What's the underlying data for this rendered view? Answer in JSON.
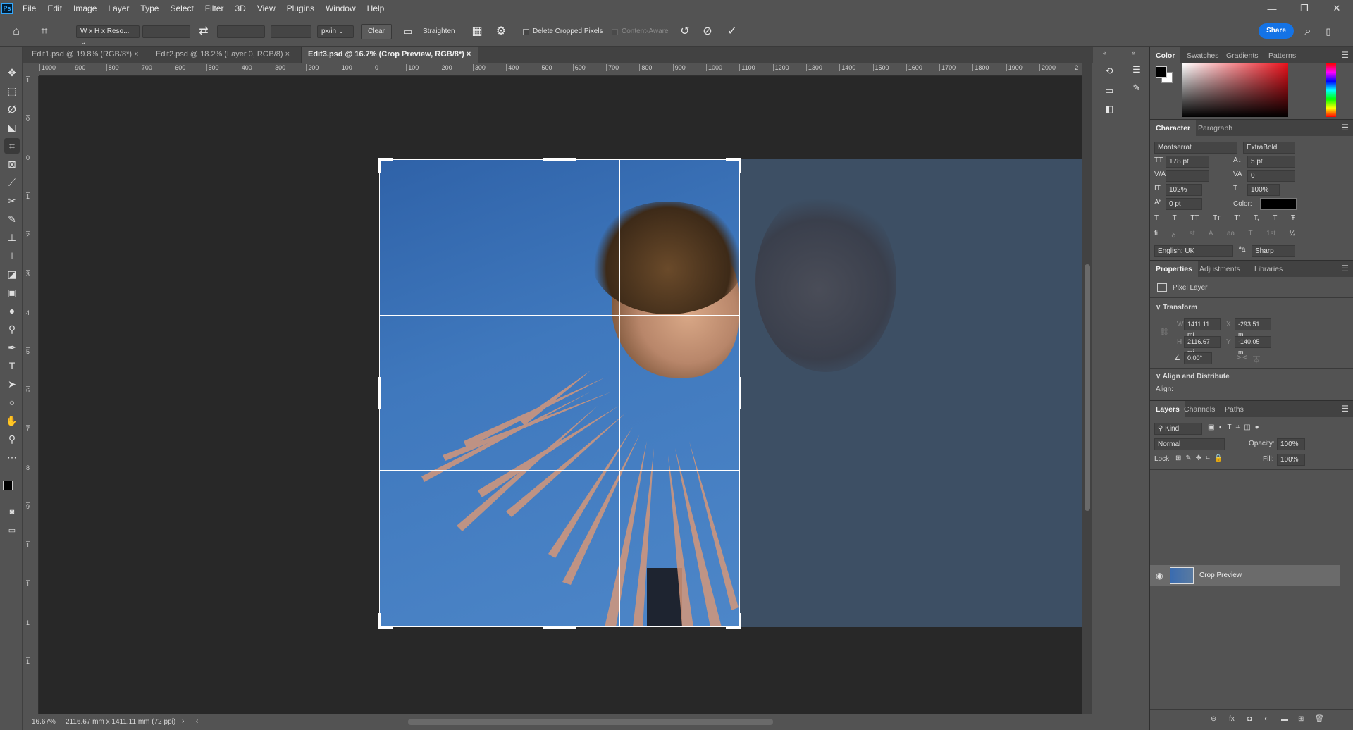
{
  "app": {
    "logo": "Ps"
  },
  "menu": [
    "File",
    "Edit",
    "Image",
    "Layer",
    "Type",
    "Select",
    "Filter",
    "3D",
    "View",
    "Plugins",
    "Window",
    "Help"
  ],
  "window_controls": {
    "minimize": "—",
    "maximize": "❐",
    "close": "✕"
  },
  "options": {
    "ratio_select": "W x H x Reso...",
    "units": "px/in",
    "clear": "Clear",
    "straighten": "Straighten",
    "delete_cropped": "Delete Cropped Pixels",
    "content_aware": "Content-Aware",
    "share": "Share"
  },
  "tabs": [
    {
      "label": "Edit1.psd @ 19.8% (RGB/8*)",
      "close": "×"
    },
    {
      "label": "Edit2.psd @ 18.2% (Layer 0, RGB/8)",
      "close": "×"
    },
    {
      "label": "Edit3.psd @ 16.7% (Crop Preview, RGB/8*)",
      "close": "×"
    }
  ],
  "ruler": {
    "h_ticks": [
      "1000",
      "900",
      "800",
      "700",
      "600",
      "500",
      "400",
      "300",
      "200",
      "100",
      "0",
      "100",
      "200",
      "300",
      "400",
      "500",
      "600",
      "700",
      "800",
      "900",
      "1000",
      "1100",
      "1200",
      "1300",
      "1400",
      "1500",
      "1600",
      "1700",
      "1800",
      "1900",
      "2000",
      "2"
    ],
    "v_ticks": [
      "1",
      "0",
      "0",
      "1",
      "2",
      "3",
      "4",
      "5",
      "6",
      "7",
      "8",
      "9",
      "1",
      "1",
      "1",
      "1"
    ]
  },
  "status": {
    "zoom": "16.67%",
    "doc_info": "2116.67 mm x 1411.11 mm (72 ppi)"
  },
  "color_panel": {
    "tabs": [
      "Color",
      "Swatches",
      "Gradients",
      "Patterns"
    ],
    "fg": "#000000",
    "bg": "#ffffff",
    "hue": "#e8101a"
  },
  "character": {
    "tabs": [
      "Character",
      "Paragraph"
    ],
    "font_family": "Montserrat",
    "font_style": "ExtraBold",
    "size": "178 pt",
    "leading": "5 pt",
    "kerning": "",
    "tracking": "0",
    "vscale": "102%",
    "hscale": "100%",
    "baseline": "0 pt",
    "color_label": "Color:",
    "style_buttons": [
      "T",
      "T",
      "TT",
      "Tт",
      "T'",
      "T,",
      "T",
      "Ŧ"
    ],
    "ot_buttons": [
      "fi",
      "ꝺ",
      "st",
      "A",
      "aa",
      "T",
      "1st",
      "½"
    ],
    "language": "English: UK",
    "aa_icon": "ªa",
    "antialias": "Sharp"
  },
  "properties": {
    "tabs": [
      "Properties",
      "Adjustments",
      "Libraries"
    ],
    "layer_type": "Pixel Layer",
    "transform_title": "Transform",
    "w_label": "W",
    "w": "1411.11 mi",
    "x_label": "X",
    "x": "-293.51 mi",
    "h_label": "H",
    "h": "2116.67 mi",
    "y_label": "Y",
    "y": "-140.05 mi",
    "angle": "0.00°",
    "align_title": "Align and Distribute",
    "align_label": "Align:"
  },
  "layers": {
    "tabs": [
      "Layers",
      "Channels",
      "Paths"
    ],
    "kind": "Kind",
    "blend": "Normal",
    "opacity_label": "Opacity:",
    "opacity": "100%",
    "lock_label": "Lock:",
    "fill_label": "Fill:",
    "fill": "100%",
    "items": [
      {
        "name": "Crop Preview",
        "visible": true
      }
    ],
    "footer_icons": [
      "link-icon",
      "fx-icon",
      "mask-icon",
      "adjustment-icon",
      "folder-icon",
      "new-layer-icon",
      "trash-icon"
    ]
  }
}
